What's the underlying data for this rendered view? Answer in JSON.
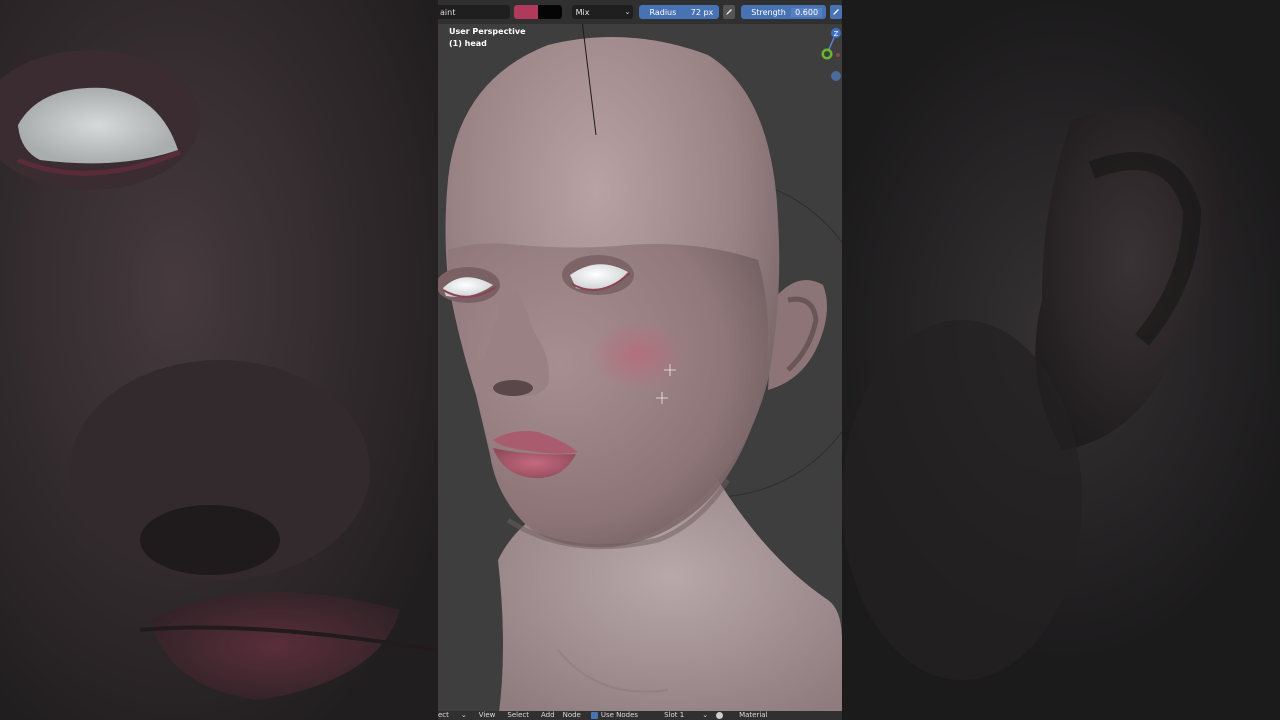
{
  "header": {
    "mode_label": "aint",
    "color_primary": "#b03a5c",
    "color_secondary": "#050505",
    "blend_mode": "Mix",
    "radius_label": "Radius",
    "radius_value": "72 px",
    "strength_label": "Strength",
    "strength_value": "0.600"
  },
  "viewport": {
    "perspective": "User Perspective",
    "object": "(1) head"
  },
  "gizmo": {
    "z_label": "Z"
  },
  "footer": {
    "mode_fragment": "ect",
    "view": "View",
    "select": "Select",
    "add": "Add",
    "node": "Node",
    "use_nodes": "Use Nodes",
    "slot": "Slot 1",
    "material": "Material"
  },
  "icons": [
    "chevron-down-icon",
    "eyedropper-icon",
    "pressure-pen-icon",
    "checkbox-icon",
    "sphere-icon",
    "axis-gizmo-icon",
    "cursor-crosshair-icon"
  ]
}
